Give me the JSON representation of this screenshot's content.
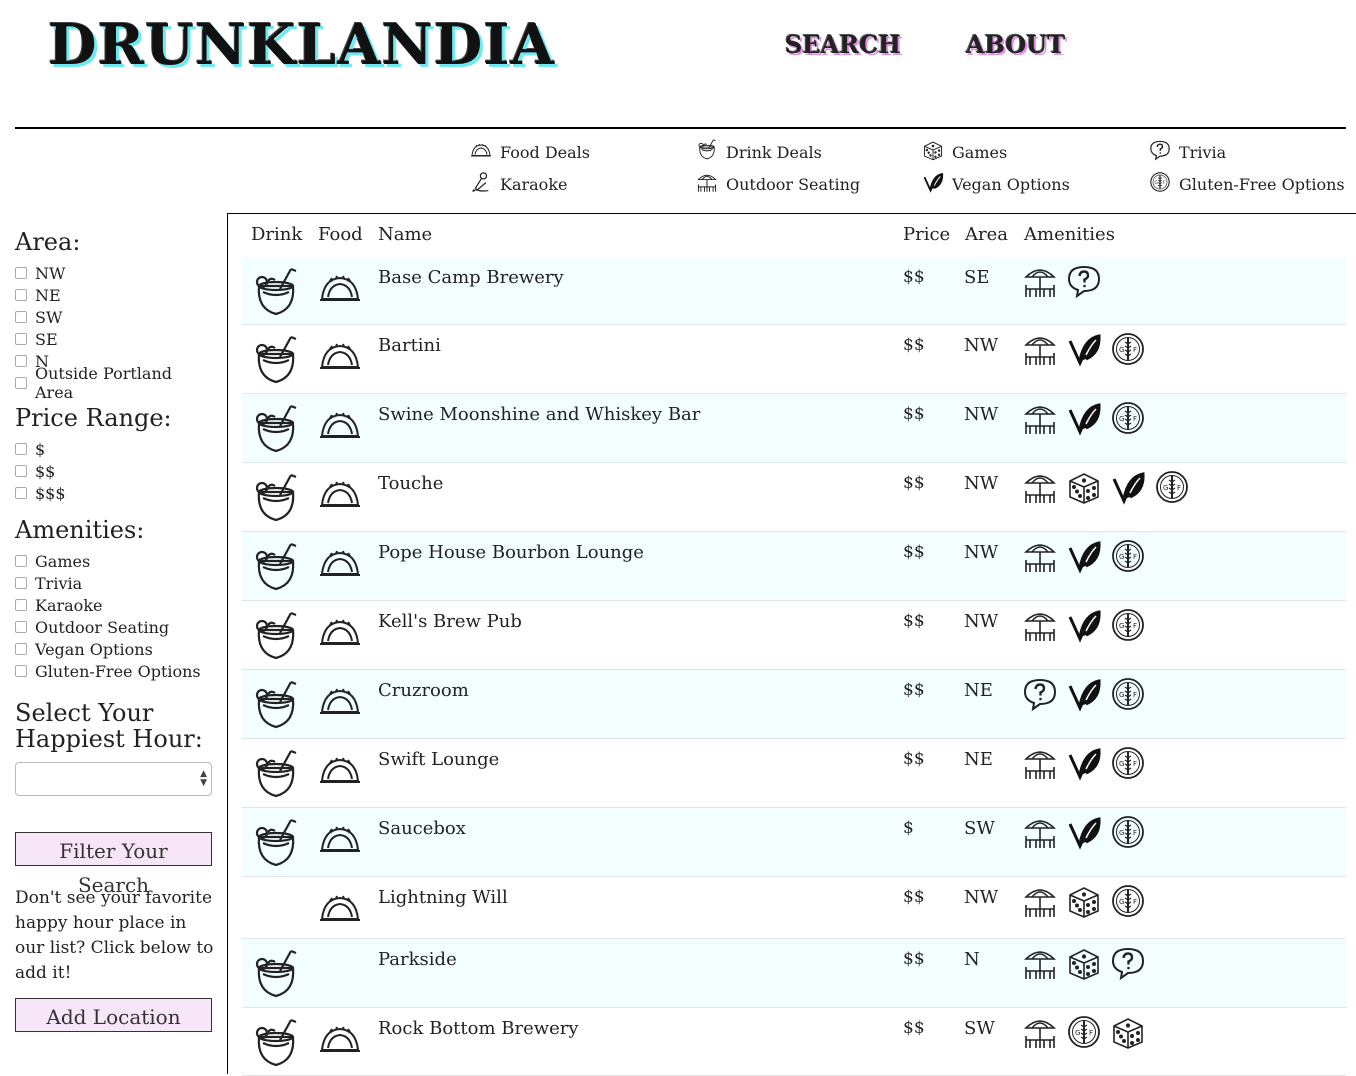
{
  "header": {
    "logo": "DRUNKLANDIA",
    "nav": [
      "SEARCH",
      "ABOUT"
    ]
  },
  "legend": [
    {
      "label": "Food Deals",
      "icon": "taco-icon"
    },
    {
      "label": "Drink Deals",
      "icon": "cocktail-icon"
    },
    {
      "label": "Games",
      "icon": "dice-icon"
    },
    {
      "label": "Trivia",
      "icon": "question-bubble-icon"
    },
    {
      "label": "Karaoke",
      "icon": "microphone-icon"
    },
    {
      "label": "Outdoor Seating",
      "icon": "patio-umbrella-icon"
    },
    {
      "label": "Vegan Options",
      "icon": "vegan-leaf-icon"
    },
    {
      "label": "Gluten-Free Options",
      "icon": "gluten-free-icon"
    }
  ],
  "sidebar": {
    "area_heading": "Area:",
    "areas": [
      "NW",
      "NE",
      "SW",
      "SE",
      "N",
      "Outside Portland Area"
    ],
    "price_heading": "Price Range:",
    "prices": [
      "$",
      "$$",
      "$$$"
    ],
    "amenities_heading": "Amenities:",
    "amenities": [
      "Games",
      "Trivia",
      "Karaoke",
      "Outdoor Seating",
      "Vegan Options",
      "Gluten-Free Options"
    ],
    "hour_heading": "Select Your Happiest Hour:",
    "hour_selected": "",
    "filter_button": "Filter Your Search",
    "note": "Don't see your favorite happy hour place in our list? Click below to add it!",
    "add_button": "Add Location"
  },
  "table": {
    "headers": [
      "Drink",
      "Food",
      "Name",
      "Price",
      "Area",
      "Amenities"
    ],
    "rows": [
      {
        "drink": true,
        "food": true,
        "name": "Base Camp Brewery",
        "price": "$$",
        "area": "SE",
        "amenities": [
          "outdoor",
          "trivia"
        ]
      },
      {
        "drink": true,
        "food": true,
        "name": "Bartini",
        "price": "$$",
        "area": "NW",
        "amenities": [
          "outdoor",
          "vegan",
          "gf"
        ]
      },
      {
        "drink": true,
        "food": true,
        "name": "Swine Moonshine and Whiskey Bar",
        "price": "$$",
        "area": "NW",
        "amenities": [
          "outdoor",
          "vegan",
          "gf"
        ]
      },
      {
        "drink": true,
        "food": true,
        "name": "Touche",
        "price": "$$",
        "area": "NW",
        "amenities": [
          "outdoor",
          "games",
          "vegan",
          "gf"
        ]
      },
      {
        "drink": true,
        "food": true,
        "name": "Pope House Bourbon Lounge",
        "price": "$$",
        "area": "NW",
        "amenities": [
          "outdoor",
          "vegan",
          "gf"
        ]
      },
      {
        "drink": true,
        "food": true,
        "name": "Kell's Brew Pub",
        "price": "$$",
        "area": "NW",
        "amenities": [
          "outdoor",
          "vegan",
          "gf"
        ]
      },
      {
        "drink": true,
        "food": true,
        "name": "Cruzroom",
        "price": "$$",
        "area": "NE",
        "amenities": [
          "trivia",
          "vegan",
          "gf"
        ]
      },
      {
        "drink": true,
        "food": true,
        "name": "Swift Lounge",
        "price": "$$",
        "area": "NE",
        "amenities": [
          "outdoor",
          "vegan",
          "gf"
        ]
      },
      {
        "drink": true,
        "food": true,
        "name": "Saucebox",
        "price": "$",
        "area": "SW",
        "amenities": [
          "outdoor",
          "vegan",
          "gf"
        ]
      },
      {
        "drink": false,
        "food": true,
        "name": "Lightning Will",
        "price": "$$",
        "area": "NW",
        "amenities": [
          "outdoor",
          "games",
          "gf"
        ]
      },
      {
        "drink": true,
        "food": false,
        "name": "Parkside",
        "price": "$$",
        "area": "N",
        "amenities": [
          "outdoor",
          "games",
          "trivia"
        ]
      },
      {
        "drink": true,
        "food": true,
        "name": "Rock Bottom Brewery",
        "price": "$$",
        "area": "SW",
        "amenities": [
          "outdoor",
          "gf",
          "games"
        ]
      }
    ]
  },
  "colors": {
    "logo_shadow": "#6ee9f2",
    "nav_shadow": "#e58be8",
    "row_tint": "#f2feff",
    "button_bg": "#f7e6f8"
  }
}
